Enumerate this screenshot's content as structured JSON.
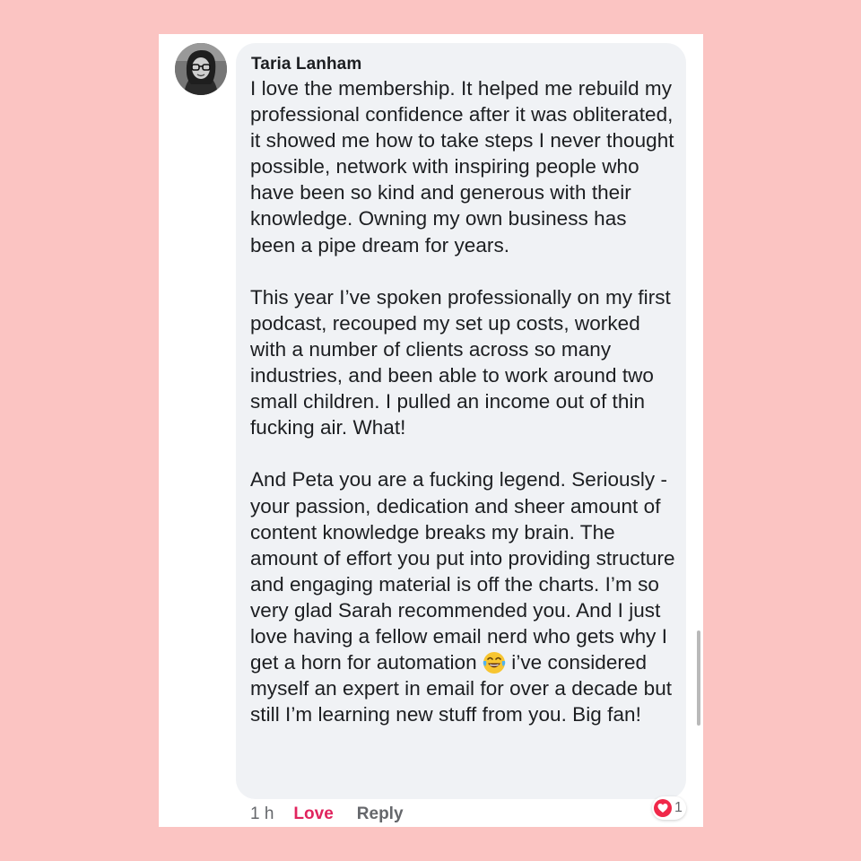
{
  "comment": {
    "author": "Taria Lanham",
    "paragraphs": [
      "I love the membership. It helped me rebuild my professional confidence after it was obliterated, it showed me how to take steps I never thought possible, network with inspiring people who have been so kind and generous with their knowledge. Owning my own business has been a pipe dream for years.",
      "This year I’ve spoken professionally on my first podcast, recouped my set up costs, worked with a number of clients across so many industries, and been able to work around two small children. I pulled an income out of thin fucking air. What!"
    ],
    "paragraph3_before_emoji": "And Peta you are a fucking legend. Seriously - your passion, dedication and sheer amount of content knowledge breaks my brain. The amount of effort you put into providing structure and engaging material is off the charts. I’m so very glad Sarah recommended you. And I just love having a fellow email nerd who gets why I get a horn for automation ",
    "paragraph3_after_emoji": " i’ve considered myself an expert in email for over a decade but still I’m learning new stuff from you. Big fan!",
    "emoji_icon": "face-with-tears-of-joy-icon"
  },
  "meta": {
    "time": "1 h",
    "love_label": "Love",
    "reply_label": "Reply"
  },
  "reaction": {
    "count": "1",
    "icon": "heart-icon",
    "color": "#f02849"
  },
  "colors": {
    "background": "#fbc4c2",
    "bubble": "#f0f2f5",
    "love": "#e0245e",
    "meta": "#65676b"
  }
}
